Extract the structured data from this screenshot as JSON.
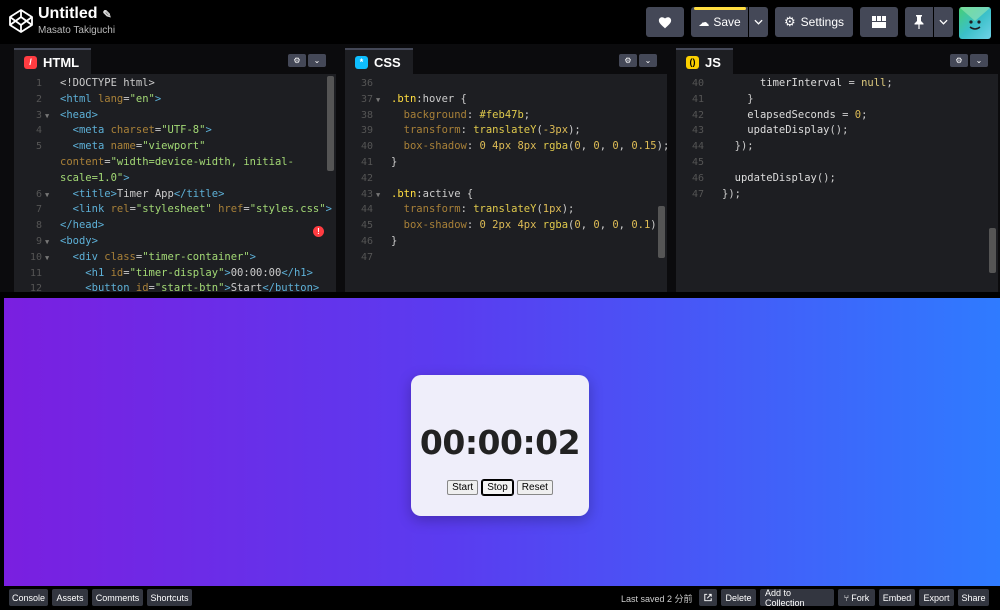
{
  "header": {
    "title": "Untitled",
    "author": "Masato Takiguchi",
    "save_label": "Save",
    "settings_label": "Settings"
  },
  "panels": {
    "html": {
      "label": "HTML",
      "lines": [
        {
          "n": "1",
          "fold": false,
          "segments": [
            [
              "pn",
              "<!DOCTYPE html>"
            ]
          ]
        },
        {
          "n": "2",
          "fold": false,
          "segments": [
            [
              "tg",
              "<html "
            ],
            [
              "at",
              "lang"
            ],
            [
              "pn",
              "="
            ],
            [
              "st",
              "\"en\""
            ],
            [
              "tg",
              ">"
            ]
          ]
        },
        {
          "n": "3",
          "fold": true,
          "segments": [
            [
              "tg",
              "<head>"
            ]
          ]
        },
        {
          "n": "4",
          "fold": false,
          "segments": [
            [
              "pn",
              "  "
            ],
            [
              "tg",
              "<meta "
            ],
            [
              "at",
              "charset"
            ],
            [
              "pn",
              "="
            ],
            [
              "st",
              "\"UTF-8\""
            ],
            [
              "tg",
              ">"
            ]
          ]
        },
        {
          "n": "5",
          "fold": false,
          "segments": [
            [
              "pn",
              "  "
            ],
            [
              "tg",
              "<meta "
            ],
            [
              "at",
              "name"
            ],
            [
              "pn",
              "="
            ],
            [
              "st",
              "\"viewport\""
            ]
          ]
        },
        {
          "n": "",
          "fold": false,
          "segments": [
            [
              "at",
              "content"
            ],
            [
              "pn",
              "="
            ],
            [
              "st",
              "\"width=device-width, initial-"
            ]
          ]
        },
        {
          "n": "",
          "fold": false,
          "segments": [
            [
              "st",
              "scale=1.0\""
            ],
            [
              "tg",
              ">"
            ]
          ]
        },
        {
          "n": "6",
          "fold": true,
          "segments": [
            [
              "pn",
              "  "
            ],
            [
              "tg",
              "<title>"
            ],
            [
              "pn",
              "Timer App"
            ],
            [
              "tg",
              "</title>"
            ]
          ]
        },
        {
          "n": "7",
          "fold": false,
          "segments": [
            [
              "pn",
              "  "
            ],
            [
              "tg",
              "<link "
            ],
            [
              "at",
              "rel"
            ],
            [
              "pn",
              "="
            ],
            [
              "st",
              "\"stylesheet\" "
            ],
            [
              "at",
              "href"
            ],
            [
              "pn",
              "="
            ],
            [
              "st",
              "\"styles.css\""
            ],
            [
              "tg",
              ">"
            ]
          ]
        },
        {
          "n": "8",
          "fold": false,
          "segments": [
            [
              "tg",
              "</head>"
            ]
          ]
        },
        {
          "n": "9",
          "fold": true,
          "segments": [
            [
              "tg",
              "<body>"
            ]
          ]
        },
        {
          "n": "10",
          "fold": true,
          "segments": [
            [
              "pn",
              "  "
            ],
            [
              "tg",
              "<div "
            ],
            [
              "at",
              "class"
            ],
            [
              "pn",
              "="
            ],
            [
              "st",
              "\"timer-container\""
            ],
            [
              "tg",
              ">"
            ]
          ]
        },
        {
          "n": "11",
          "fold": false,
          "segments": [
            [
              "pn",
              "    "
            ],
            [
              "tg",
              "<h1 "
            ],
            [
              "at",
              "id"
            ],
            [
              "pn",
              "="
            ],
            [
              "st",
              "\"timer-display\""
            ],
            [
              "tg",
              ">"
            ],
            [
              "pn",
              "00:00:00"
            ],
            [
              "tg",
              "</h1>"
            ]
          ]
        },
        {
          "n": "12",
          "fold": false,
          "segments": [
            [
              "pn",
              "    "
            ],
            [
              "tg",
              "<button "
            ],
            [
              "at",
              "id"
            ],
            [
              "pn",
              "="
            ],
            [
              "st",
              "\"start-btn\""
            ],
            [
              "tg",
              ">"
            ],
            [
              "pn",
              "Start"
            ],
            [
              "tg",
              "</button>"
            ]
          ]
        }
      ]
    },
    "css": {
      "label": "CSS",
      "lines": [
        {
          "n": "36",
          "segments": []
        },
        {
          "n": "37",
          "fold": true,
          "segments": [
            [
              "sel",
              ".btn"
            ],
            [
              "pn",
              ":hover {"
            ]
          ]
        },
        {
          "n": "38",
          "segments": [
            [
              "pn",
              "  "
            ],
            [
              "pr",
              "background"
            ],
            [
              "pn",
              ": "
            ],
            [
              "val",
              "#feb47b"
            ],
            [
              "pn",
              ";"
            ]
          ]
        },
        {
          "n": "39",
          "segments": [
            [
              "pn",
              "  "
            ],
            [
              "pr",
              "transform"
            ],
            [
              "pn",
              ": "
            ],
            [
              "val",
              "translateY"
            ],
            [
              "pn",
              "("
            ],
            [
              "num",
              "-3px"
            ],
            [
              "pn",
              ");"
            ]
          ]
        },
        {
          "n": "40",
          "segments": [
            [
              "pn",
              "  "
            ],
            [
              "pr",
              "box-shadow"
            ],
            [
              "pn",
              ": "
            ],
            [
              "num",
              "0 4px 8px "
            ],
            [
              "val",
              "rgba"
            ],
            [
              "pn",
              "("
            ],
            [
              "num",
              "0"
            ],
            [
              "pn",
              ", "
            ],
            [
              "num",
              "0"
            ],
            [
              "pn",
              ", "
            ],
            [
              "num",
              "0"
            ],
            [
              "pn",
              ", "
            ],
            [
              "num",
              "0.15"
            ],
            [
              "pn",
              ");"
            ]
          ]
        },
        {
          "n": "41",
          "segments": [
            [
              "pn",
              "}"
            ]
          ]
        },
        {
          "n": "42",
          "segments": []
        },
        {
          "n": "43",
          "fold": true,
          "segments": [
            [
              "sel",
              ".btn"
            ],
            [
              "pn",
              ":active {"
            ]
          ]
        },
        {
          "n": "44",
          "segments": [
            [
              "pn",
              "  "
            ],
            [
              "pr",
              "transform"
            ],
            [
              "pn",
              ": "
            ],
            [
              "val",
              "translateY"
            ],
            [
              "pn",
              "("
            ],
            [
              "num",
              "1px"
            ],
            [
              "pn",
              ");"
            ]
          ]
        },
        {
          "n": "45",
          "segments": [
            [
              "pn",
              "  "
            ],
            [
              "pr",
              "box-shadow"
            ],
            [
              "pn",
              ": "
            ],
            [
              "num",
              "0 2px 4px "
            ],
            [
              "val",
              "rgba"
            ],
            [
              "pn",
              "("
            ],
            [
              "num",
              "0"
            ],
            [
              "pn",
              ", "
            ],
            [
              "num",
              "0"
            ],
            [
              "pn",
              ", "
            ],
            [
              "num",
              "0"
            ],
            [
              "pn",
              ", "
            ],
            [
              "num",
              "0.1"
            ],
            [
              "pn",
              ");"
            ]
          ]
        },
        {
          "n": "46",
          "segments": [
            [
              "pn",
              "}"
            ]
          ]
        },
        {
          "n": "47",
          "segments": []
        }
      ]
    },
    "js": {
      "label": "JS",
      "lines": [
        {
          "n": "40",
          "segments": [
            [
              "pn",
              "      "
            ],
            [
              "vb",
              "timerInterval"
            ],
            [
              "pn",
              " = "
            ],
            [
              "kw",
              "null"
            ],
            [
              "pn",
              ";"
            ]
          ]
        },
        {
          "n": "41",
          "segments": [
            [
              "pn",
              "    }"
            ]
          ]
        },
        {
          "n": "42",
          "segments": [
            [
              "pn",
              "    "
            ],
            [
              "vb",
              "elapsedSeconds"
            ],
            [
              "pn",
              " = "
            ],
            [
              "num",
              "0"
            ],
            [
              "pn",
              ";"
            ]
          ]
        },
        {
          "n": "43",
          "segments": [
            [
              "pn",
              "    "
            ],
            [
              "vb",
              "updateDisplay"
            ],
            [
              "pn",
              "();"
            ]
          ]
        },
        {
          "n": "44",
          "segments": [
            [
              "pn",
              "  });"
            ]
          ]
        },
        {
          "n": "45",
          "segments": []
        },
        {
          "n": "46",
          "segments": [
            [
              "pn",
              "  "
            ],
            [
              "vb",
              "updateDisplay"
            ],
            [
              "pn",
              "();"
            ]
          ]
        },
        {
          "n": "47",
          "segments": [
            [
              "pn",
              "});"
            ]
          ]
        }
      ]
    }
  },
  "preview": {
    "timer": "00:00:02",
    "buttons": [
      "Start",
      "Stop",
      "Reset"
    ]
  },
  "footer": {
    "left_buttons": [
      "Console",
      "Assets",
      "Comments",
      "Shortcuts"
    ],
    "saved": "Last saved 2 分前",
    "right_buttons": [
      "Delete",
      "Add to Collection",
      "Fork",
      "Embed",
      "Export",
      "Share"
    ]
  },
  "colors": {
    "html_badge": "#ff3c41",
    "css_badge": "#0ebeff",
    "js_badge": "#fcd000",
    "save_accent": "#ffdd40",
    "gradient_start": "#7a1fe0",
    "gradient_end": "#2f7bff"
  }
}
